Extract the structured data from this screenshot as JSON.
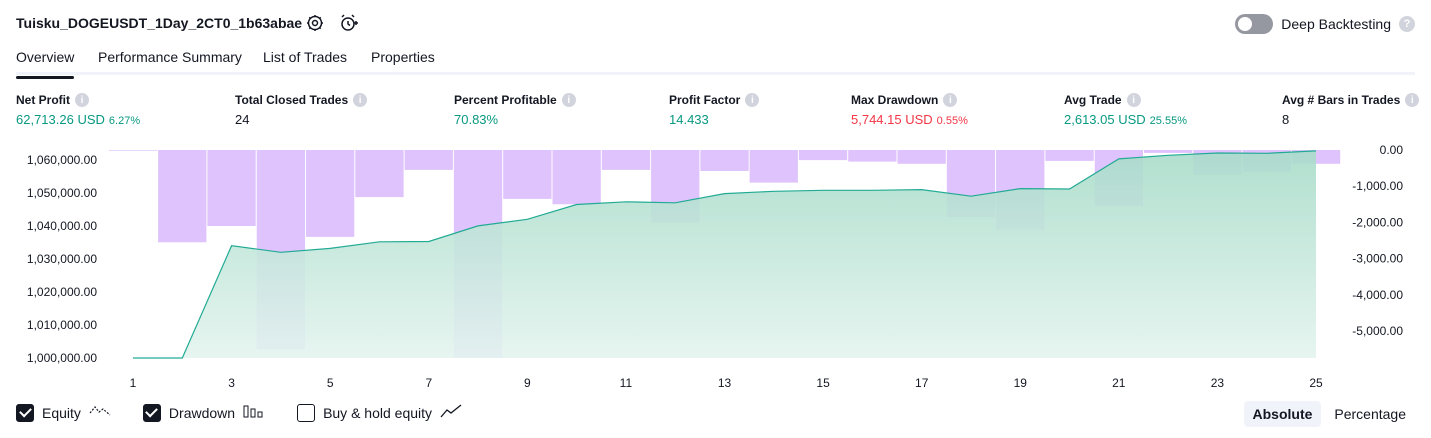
{
  "header": {
    "strategy_name": "Tuisku_DOGEUSDT_1Day_2CT0_1b63abae",
    "deep_backtesting_label": "Deep Backtesting",
    "help_glyph": "?"
  },
  "tabs": [
    {
      "label": "Overview",
      "active": true
    },
    {
      "label": "Performance Summary",
      "active": false
    },
    {
      "label": "List of Trades",
      "active": false
    },
    {
      "label": "Properties",
      "active": false
    }
  ],
  "metrics": [
    {
      "label": "Net Profit",
      "value": "62,713.26 USD",
      "pct": "6.27%",
      "color": "green"
    },
    {
      "label": "Total Closed Trades",
      "value": "24",
      "pct": "",
      "color": "dark"
    },
    {
      "label": "Percent Profitable",
      "value": "70.83%",
      "pct": "",
      "color": "green"
    },
    {
      "label": "Profit Factor",
      "value": "14.433",
      "pct": "",
      "color": "green"
    },
    {
      "label": "Max Drawdown",
      "value": "5,744.15 USD",
      "pct": "0.55%",
      "color": "red"
    },
    {
      "label": "Avg Trade",
      "value": "2,613.05 USD",
      "pct": "25.55%",
      "color": "green"
    },
    {
      "label": "Avg # Bars in Trades",
      "value": "8",
      "pct": "",
      "color": "dark"
    }
  ],
  "info_glyph": "i",
  "chart_data": {
    "type": "area",
    "x": [
      1,
      2,
      3,
      4,
      5,
      6,
      7,
      8,
      9,
      10,
      11,
      12,
      13,
      14,
      15,
      16,
      17,
      18,
      19,
      20,
      21,
      22,
      23,
      24,
      25
    ],
    "x_ticks": [
      "1",
      "3",
      "5",
      "7",
      "9",
      "11",
      "13",
      "15",
      "17",
      "19",
      "21",
      "23",
      "25"
    ],
    "left_axis": {
      "ticks": [
        "1,000,000.00",
        "1,010,000.00",
        "1,020,000.00",
        "1,030,000.00",
        "1,040,000.00",
        "1,050,000.00",
        "1,060,000.00"
      ],
      "ylim": [
        1000000,
        1063000
      ]
    },
    "right_axis": {
      "ticks": [
        "0.00",
        "-1,000.00",
        "-2,000.00",
        "-3,000.00",
        "-4,000.00",
        "-5,000.00"
      ],
      "ylim": [
        -5744.15,
        0
      ]
    },
    "series": [
      {
        "name": "Equity",
        "values": [
          1000000,
          1000000,
          1034000,
          1032000,
          1033200,
          1035200,
          1035300,
          1040000,
          1042000,
          1046500,
          1047300,
          1047000,
          1049800,
          1050500,
          1050800,
          1050800,
          1051000,
          1049000,
          1051300,
          1051200,
          1060300,
          1061400,
          1062100,
          1062000,
          1062713
        ]
      },
      {
        "name": "Drawdown",
        "values": [
          -20,
          -2550,
          -2100,
          -5500,
          -2400,
          -1300,
          -550,
          -5744,
          -1350,
          -1500,
          -550,
          -2000,
          -580,
          -900,
          -280,
          -320,
          -380,
          -1850,
          -2200,
          -300,
          -1550,
          -80,
          -680,
          -600,
          -380
        ]
      }
    ],
    "colors": {
      "equity_line": "#22ab94",
      "equity_fill": "#b9e3d7",
      "drawdown_bar": "#d9b8fb",
      "axis_text": "#131722"
    }
  },
  "legend": [
    {
      "label": "Equity",
      "checked": true,
      "icon": "equity-line-icon"
    },
    {
      "label": "Drawdown",
      "checked": true,
      "icon": "drawdown-bars-icon"
    },
    {
      "label": "Buy & hold equity",
      "checked": false,
      "icon": "buy-hold-line-icon"
    }
  ],
  "mode_buttons": [
    {
      "label": "Absolute",
      "active": true
    },
    {
      "label": "Percentage",
      "active": false
    }
  ]
}
